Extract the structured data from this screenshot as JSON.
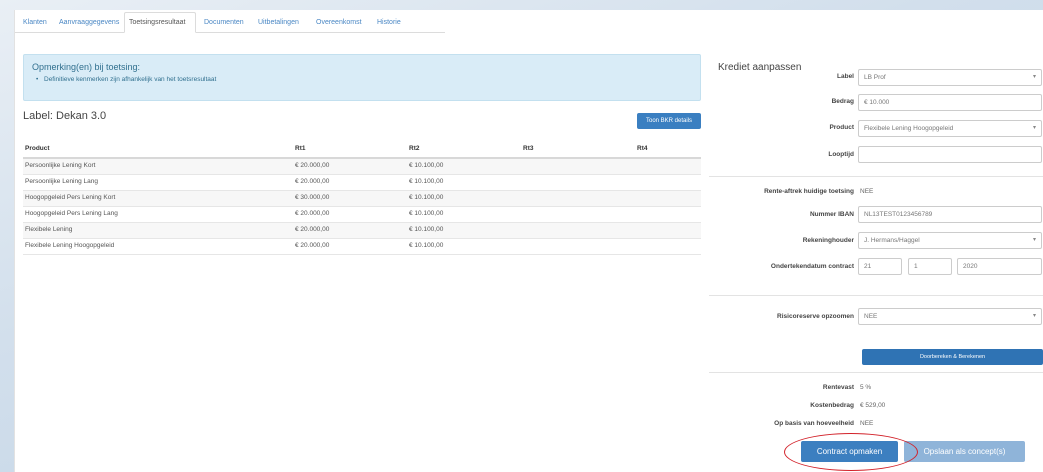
{
  "tabs": [
    {
      "label": "Klanten"
    },
    {
      "label": "Aanvraaggegevens"
    },
    {
      "label": "Toetsingsresultaat"
    },
    {
      "label": "Documenten"
    },
    {
      "label": "Uitbetalingen"
    },
    {
      "label": "Overeenkomst"
    },
    {
      "label": "Historie"
    }
  ],
  "active_tab": "Toetsingsresultaat",
  "info": {
    "title": "Opmerking(en) bij toetsing:",
    "item": "Definitieve kenmerken zijn afhankelijk van het toetsresultaat"
  },
  "label_heading": "Label: Dekan 3.0",
  "details_button": "Toon BKR details",
  "table": {
    "columns": [
      "Product",
      "Rt1",
      "Rt2",
      "Rt3",
      "Rt4"
    ],
    "rows": [
      [
        "Persoonlijke Lening Kort",
        "€ 20.000,00",
        "€ 10.100,00",
        "",
        ""
      ],
      [
        "Persoonlijke Lening Lang",
        "€ 20.000,00",
        "€ 10.100,00",
        "",
        ""
      ],
      [
        "Hoogopgeleid Pers Lening Kort",
        "€ 30.000,00",
        "€ 10.100,00",
        "",
        ""
      ],
      [
        "Hoogopgeleid Pers Lening Lang",
        "€ 20.000,00",
        "€ 10.100,00",
        "",
        ""
      ],
      [
        "Flexibele Lening",
        "€ 20.000,00",
        "€ 10.100,00",
        "",
        ""
      ],
      [
        "Flexibele Lening Hoogopgeleid",
        "€ 20.000,00",
        "€ 10.100,00",
        "",
        ""
      ]
    ]
  },
  "right_panel": {
    "title": "Krediet aanpassen",
    "label_field": {
      "label": "Label",
      "value": "LB Prof"
    },
    "bedrag_field": {
      "label": "Bedrag",
      "value": "€ 10.000"
    },
    "product_field": {
      "label": "Product",
      "value": "Flexibele Lening Hoogopgeleid"
    },
    "looptijd_field": {
      "label": "Looptijd",
      "value": ""
    },
    "renteaftrek": {
      "label": "Rente-aftrek huidige toetsing",
      "value": "NEE"
    },
    "iban_field": {
      "label": "Nummer IBAN",
      "value": "NL13TEST0123456789"
    },
    "rekeninghouder_field": {
      "label": "Rekeninghouder",
      "value": "J. Hermans/Haggel"
    },
    "datum_field": {
      "label": "Ondertekendatum contract",
      "day": "21",
      "month": "1",
      "year": "2020"
    },
    "risico_field": {
      "label": "Risicoreserve opzoomen",
      "value": "NEE"
    },
    "wide_button": "Doorbereken & Berekenen",
    "rentevast": {
      "label": "Rentevast",
      "value": "5 %"
    },
    "kosten": {
      "label": "Kostenbedrag",
      "value": "€ 529,00"
    },
    "basis": {
      "label": "Op basis van hoeveelheid",
      "value": "NEE"
    }
  },
  "actions": {
    "contract_button": "Contract opmaken",
    "secondary_button": "Opslaan als concept(s)"
  },
  "colors": {
    "accent": "#3c7fc0",
    "info_bg": "#d9ecf7",
    "highlight_ellipse": "#d2222a"
  }
}
